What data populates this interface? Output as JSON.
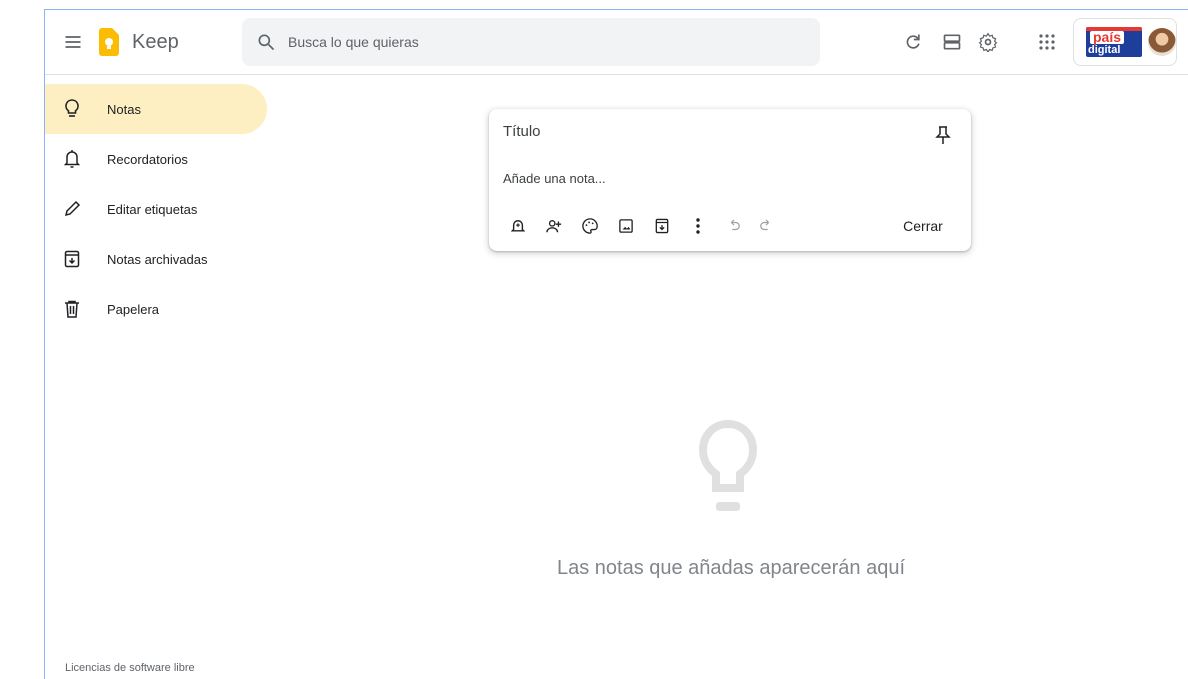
{
  "header": {
    "app_name": "Keep",
    "search_placeholder": "Busca lo que quieras",
    "icons": [
      "menu-icon",
      "keep-logo",
      "search-icon",
      "refresh-icon",
      "list-view-icon",
      "settings-icon",
      "apps-grid-icon"
    ],
    "account_brand": {
      "line1": "país",
      "line2": "digital"
    }
  },
  "sidebar": {
    "items": [
      {
        "label": "Notas",
        "icon": "lightbulb-icon",
        "active": true
      },
      {
        "label": "Recordatorios",
        "icon": "bell-icon",
        "active": false
      },
      {
        "label": "Editar etiquetas",
        "icon": "pencil-icon",
        "active": false
      },
      {
        "label": "Notas archivadas",
        "icon": "archive-icon",
        "active": false
      },
      {
        "label": "Papelera",
        "icon": "trash-icon",
        "active": false
      }
    ],
    "footer_link": "Licencias de software libre"
  },
  "note_editor": {
    "title_placeholder": "Título",
    "body_placeholder": "Añade una nota...",
    "close_label": "Cerrar",
    "tools": [
      "remind-icon",
      "collaborator-icon",
      "palette-icon",
      "image-icon",
      "archive-icon",
      "more-icon",
      "undo-icon",
      "redo-icon"
    ]
  },
  "empty_state": {
    "message": "Las notas que añadas aparecerán aquí"
  },
  "colors": {
    "active_nav": "#feefc3",
    "keep_yellow": "#fbbc04",
    "search_bg": "#f1f3f4",
    "icon_gray": "#5f6368"
  }
}
